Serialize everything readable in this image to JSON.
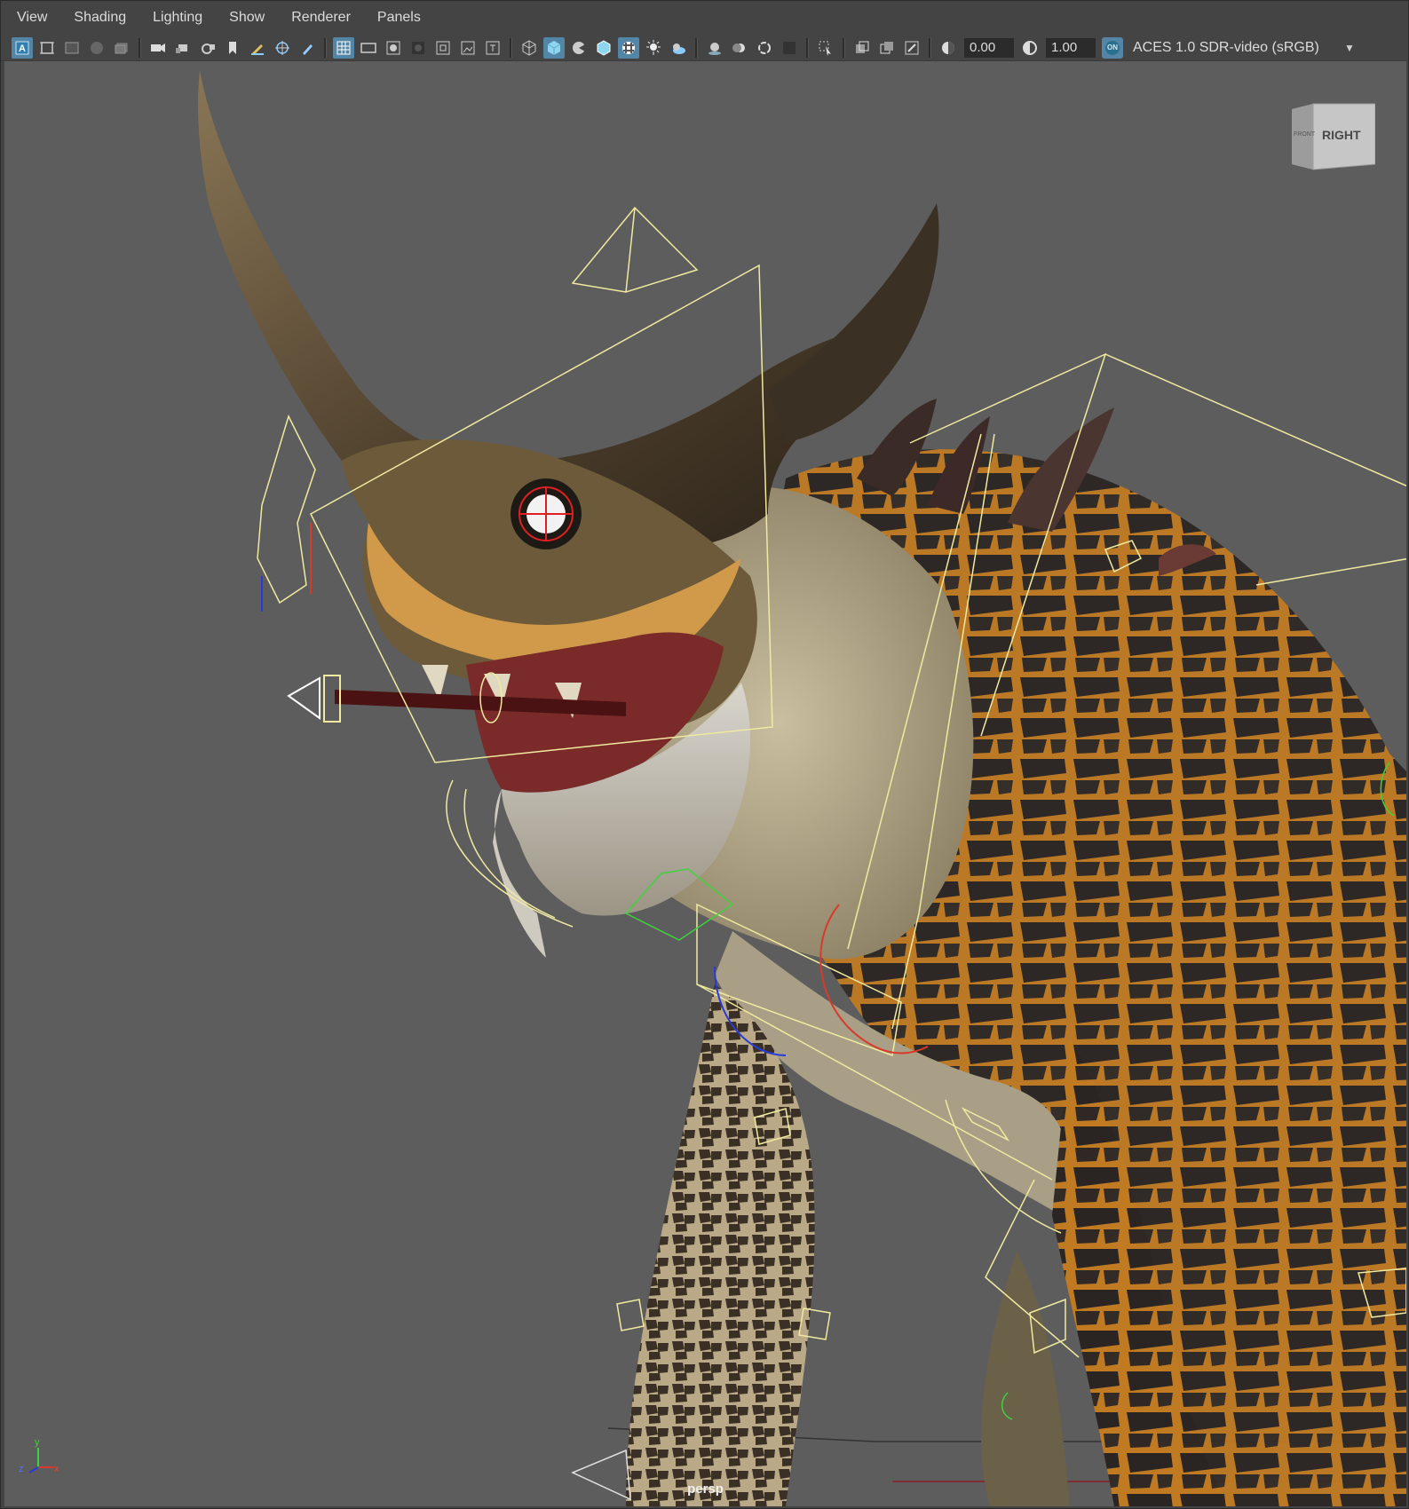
{
  "menubar": {
    "items": [
      "View",
      "Shading",
      "Lighting",
      "Show",
      "Renderer",
      "Panels"
    ]
  },
  "toolbar": {
    "exposure_value": "0.00",
    "gamma_value": "1.00",
    "color_mgmt_toggle": "ON",
    "view_transform": "ACES 1.0 SDR-video (sRGB)"
  },
  "viewport": {
    "camera_label": "persp",
    "viewcube": {
      "front_label": "FRONT",
      "right_label": "RIGHT"
    },
    "axis_gizmo": {
      "y": "y",
      "z": "z",
      "x": "x"
    }
  },
  "colors": {
    "accent": "#5285a6",
    "viewport_bg": "#5d5d5d",
    "ui_bg": "#444444",
    "rig_curve": "#f0eaa0",
    "selection_green": "#3fd13f",
    "joint_red": "#d83a2a"
  }
}
